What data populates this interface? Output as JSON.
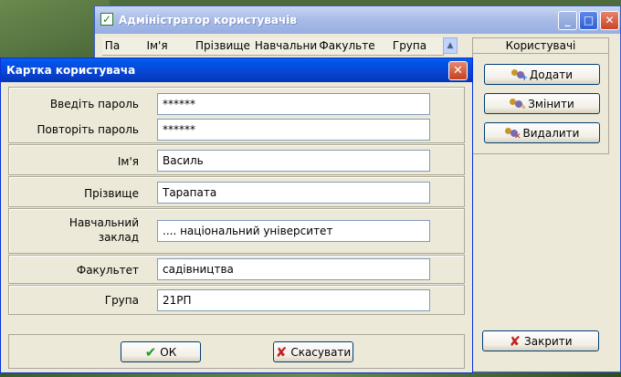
{
  "admin_window": {
    "title": "Адміністратор користувачів",
    "columns": [
      "Па",
      "Ім'я",
      "Прізвище",
      "Навчальни",
      "Факульте",
      "Група"
    ],
    "users_panel": {
      "title": "Користувачі",
      "add_label": "Додати",
      "edit_label": "Змінити",
      "delete_label": "Видалити"
    },
    "close_label": "Закрити"
  },
  "card_dialog": {
    "title": "Картка користувача",
    "password_label": "Введіть пароль",
    "password_value": "******",
    "repeat_label": "Повторіть пароль",
    "repeat_value": "******",
    "first_name_label": "Ім'я",
    "first_name_value": "Василь",
    "last_name_label": "Прізвище",
    "last_name_value": "Тарапата",
    "institution_label_line1": "Навчальний",
    "institution_label_line2": "заклад",
    "institution_value": ".... національний університет",
    "faculty_label": "Факультет",
    "faculty_value": "садівництва",
    "group_label": "Група",
    "group_value": "21РП",
    "ok_label": "ОК",
    "cancel_label": "Скасувати"
  },
  "icons": {
    "check": "check-icon",
    "cross": "cross-icon",
    "users": "users-icon"
  },
  "colors": {
    "title_bar": "#0a5fe8",
    "inactive_title_bar": "#a9bde8",
    "dialog_bg": "#ece9d8",
    "ok_check": "#1f9a1f",
    "cancel_cross": "#c42222"
  }
}
